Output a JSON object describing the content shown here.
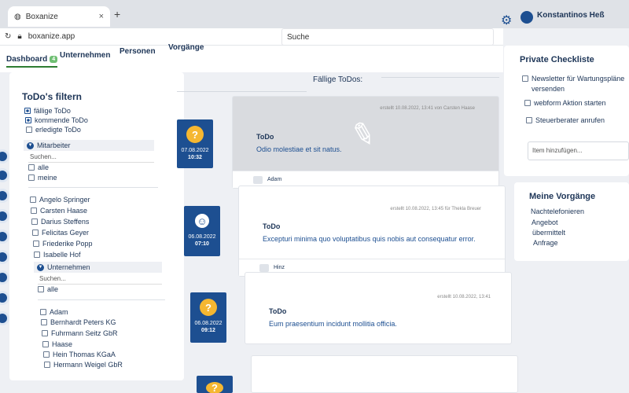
{
  "browser": {
    "tab_title": "Boxanize",
    "tab_close": "×",
    "new_tab": "+",
    "url": "boxanize.app"
  },
  "header": {
    "search_placeholder": "Suche",
    "user_name": "Konstantinos Heß",
    "nav": [
      {
        "label": "Dashboard",
        "badge": "4"
      },
      {
        "label": "Unternehmen"
      },
      {
        "label": "Personen"
      },
      {
        "label": "Vorgänge"
      }
    ]
  },
  "filter": {
    "title": "ToDo's filtern",
    "statuses": [
      {
        "label": "fällige ToDo",
        "checked": true
      },
      {
        "label": "kommende ToDo",
        "checked": true
      },
      {
        "label": "erledigte ToDo",
        "checked": false
      }
    ],
    "mitarbeiter": {
      "label": "Mitarbeiter",
      "search": "Suchen...",
      "options": [
        "alle",
        "meine"
      ],
      "people": [
        "Angelo Springer",
        "Carsten Haase",
        "Darius Steffens",
        "Felicitas Geyer",
        "Friederike Popp",
        "Isabelle Hof"
      ]
    },
    "unternehmen": {
      "label": "Unternehmen",
      "search": "Suchen...",
      "options": [
        "alle"
      ],
      "companies": [
        "Adam",
        "Bernhardt Peters KG",
        "Fuhrmann Seitz GbR",
        "Haase",
        "Hein Thomas KGaA",
        "Hermann Weigel GbR"
      ]
    }
  },
  "todos": {
    "section_title": "Fällige ToDos:",
    "items": [
      {
        "date": "07.08.2022",
        "time": "10:32",
        "icon": "question-icon",
        "meta": "erstellt 10.08.2022, 13:41 von Carsten Haase",
        "title": "ToDo",
        "text": "Odio molestiae et sit natus.",
        "footer": "Adam",
        "highlighted": true
      },
      {
        "date": "06.08.2022",
        "time": "07:10",
        "icon": "person-icon",
        "meta": "erstellt 10.08.2022, 13:45 für Thekla Breuer",
        "title": "ToDo",
        "text": "Excepturi minima quo voluptatibus quis nobis aut consequatur error.",
        "footer": "Hinz",
        "highlighted": false
      },
      {
        "date": "06.08.2022",
        "time": "09:12",
        "icon": "question-icon",
        "meta": "erstellt 10.08.2022, 13:41",
        "title": "ToDo",
        "text": "Eum praesentium incidunt mollitia officia.",
        "footer": "",
        "highlighted": false
      }
    ]
  },
  "checklist": {
    "title": "Private Checkliste",
    "items": [
      "Newsletter für Wartungspläne versenden",
      "webform Aktion starten",
      "Steuerberater anrufen"
    ],
    "add_placeholder": "Item hinzufügen..."
  },
  "vorgaenge": {
    "title": "Meine Vorgänge",
    "items": [
      "Nachtelefonieren",
      "Angebot",
      "übermittelt",
      "Anfrage"
    ]
  },
  "colors": {
    "primary": "#1d4f91",
    "accent": "#f5b731",
    "badge": "#6fbf73"
  }
}
